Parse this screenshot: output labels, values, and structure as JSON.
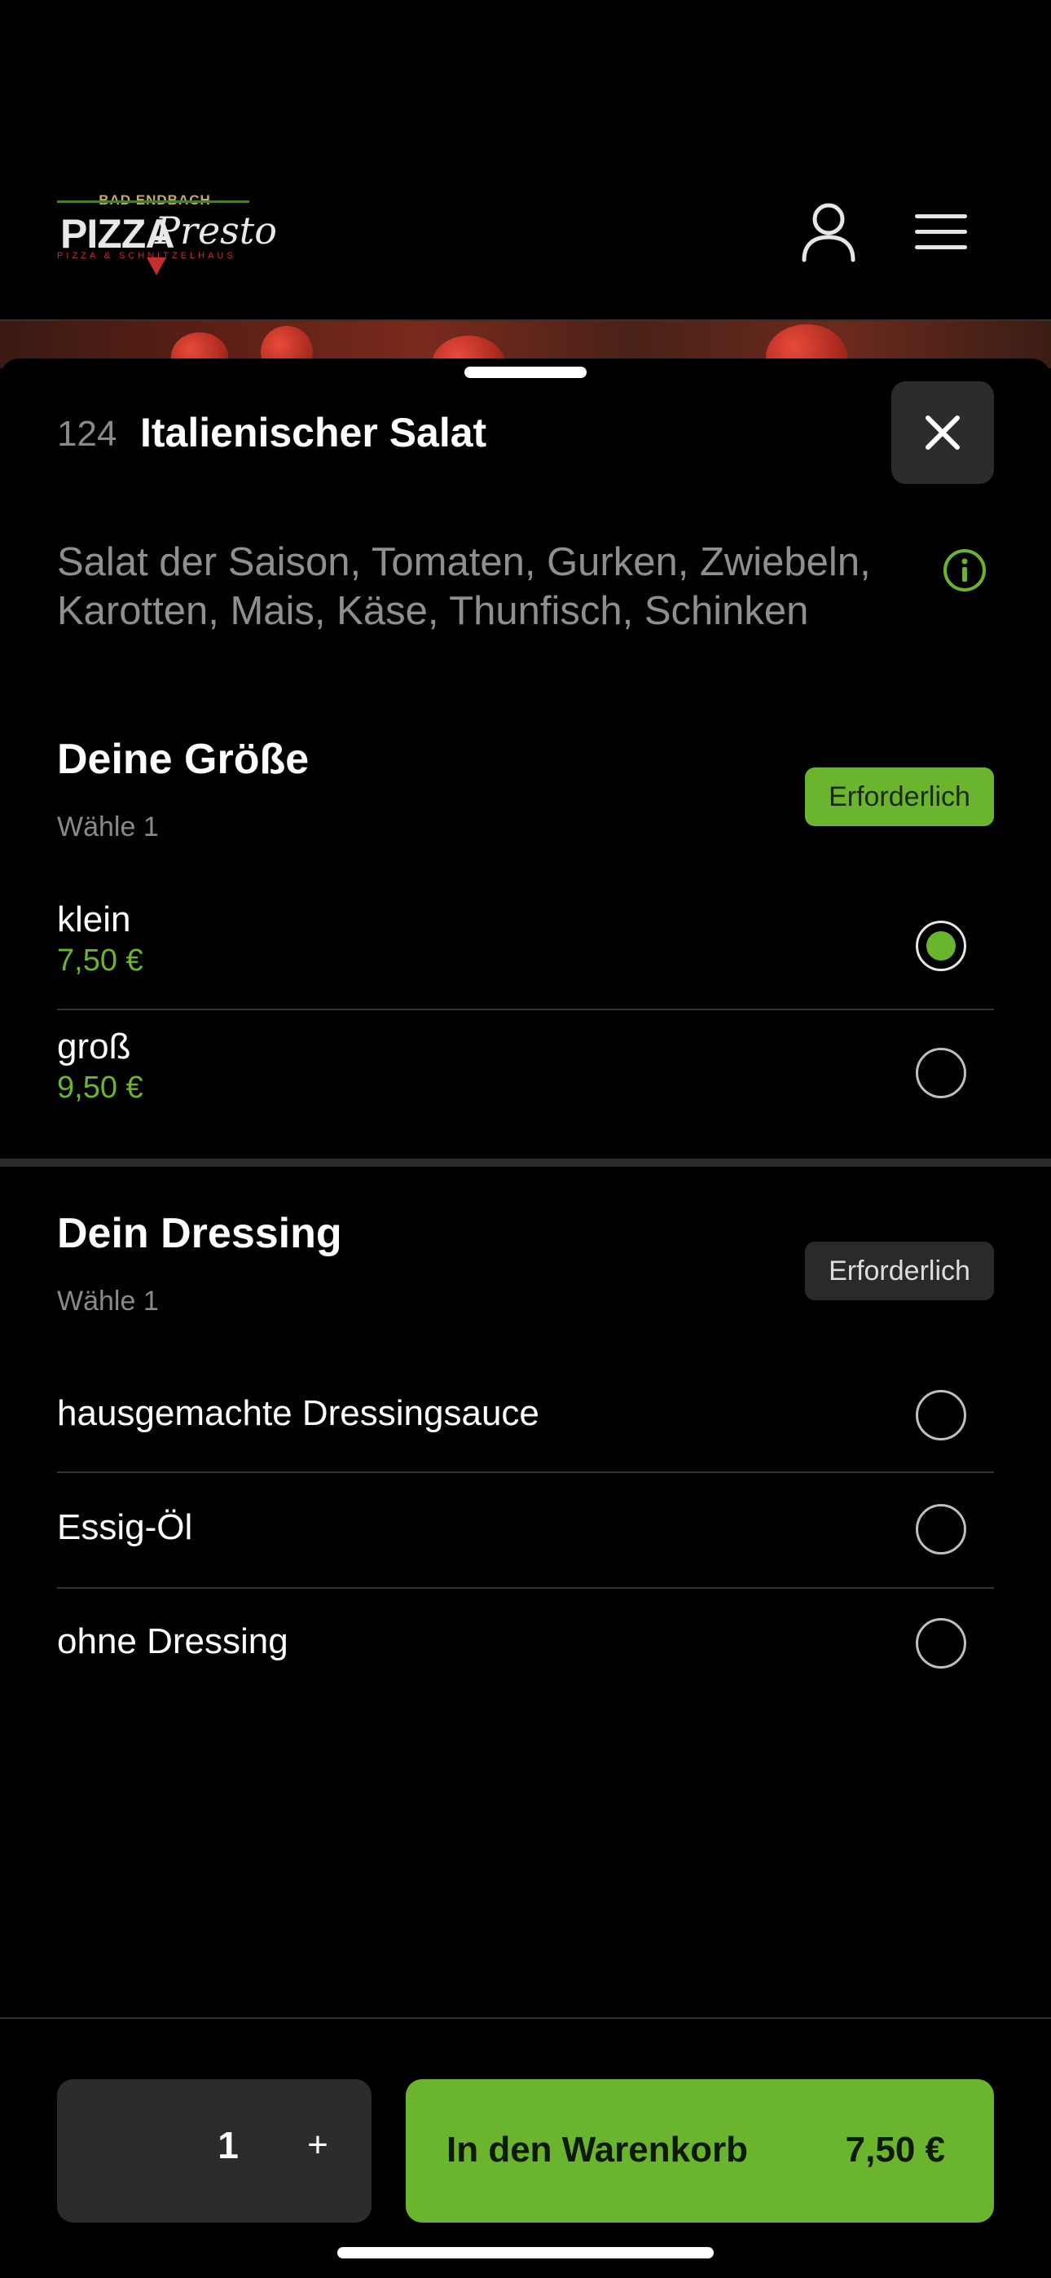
{
  "header": {
    "logo": {
      "top_text": "BAD ENDBACH",
      "main_text": "PIZZA",
      "script_text": "Presto",
      "tagline": "PIZZA & SCHNITZELHAUS"
    },
    "icons": {
      "account": "user-icon",
      "menu": "hamburger-menu-icon"
    }
  },
  "item": {
    "number": "124",
    "title": "Italienischer Salat",
    "description": "Salat der Saison, Tomaten, Gurken, Zwiebeln, Karotten, Mais, Käse, Thunfisch, Schinken",
    "close_icon": "close-icon",
    "info_icon": "info-icon"
  },
  "size_section": {
    "title": "Deine Größe",
    "subtitle": "Wähle 1",
    "badge": "Erforderlich",
    "badge_color": "#6ab42e",
    "options": [
      {
        "name": "klein",
        "price": "7,50 €",
        "selected": true
      },
      {
        "name": "groß",
        "price": "9,50 €",
        "selected": false
      }
    ]
  },
  "dressing_section": {
    "title": "Dein Dressing",
    "subtitle": "Wähle 1",
    "badge": "Erforderlich",
    "options": [
      {
        "name": "hausgemachte Dressingsauce",
        "selected": false
      },
      {
        "name": "Essig-Öl",
        "selected": false
      },
      {
        "name": "ohne Dressing",
        "selected": false
      }
    ]
  },
  "footer": {
    "quantity": "1",
    "plus_label": "+",
    "cart_label": "In den Warenkorb",
    "cart_price": "7,50 €"
  },
  "colors": {
    "accent": "#6ab42e",
    "background": "#000000",
    "surface": "#2c2c2c"
  }
}
